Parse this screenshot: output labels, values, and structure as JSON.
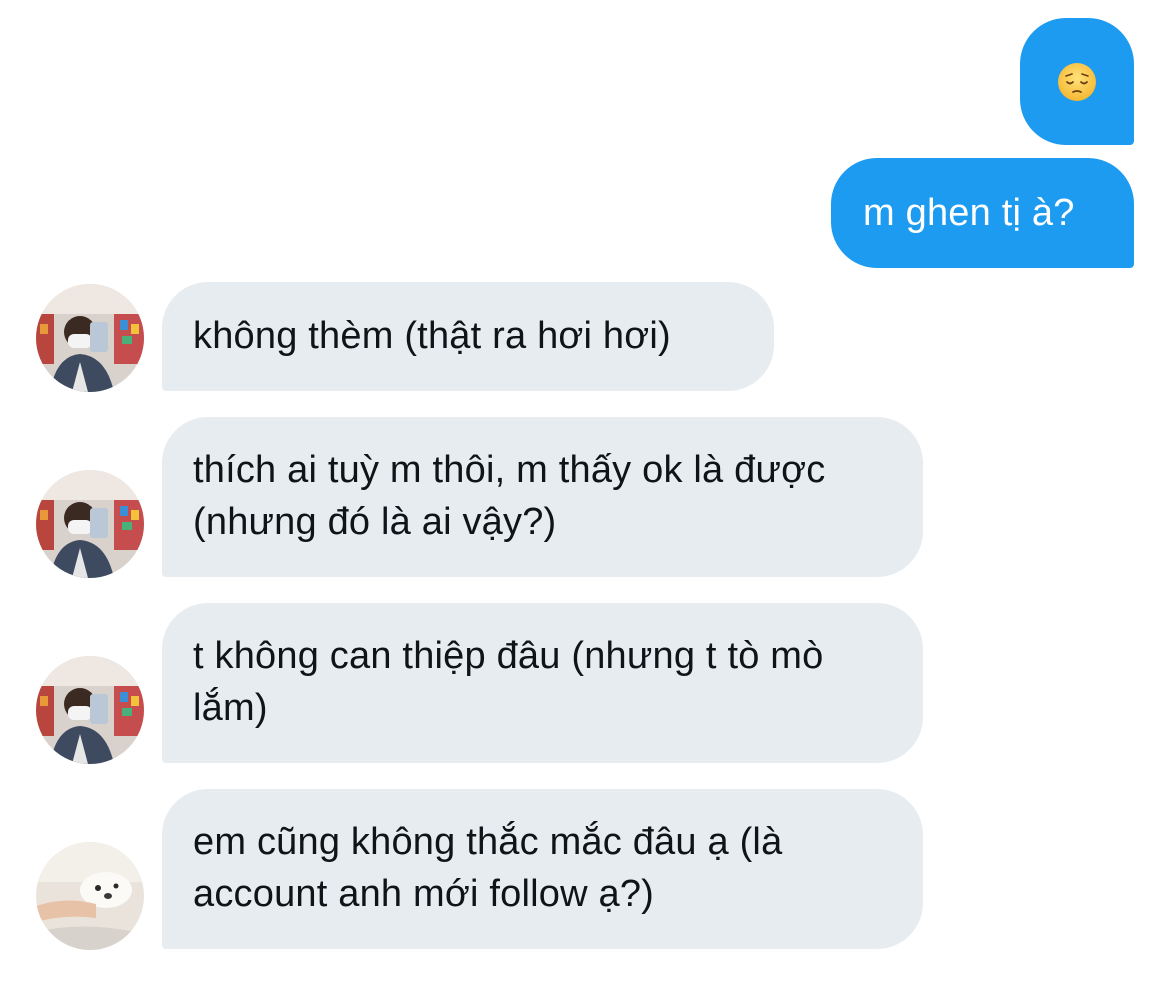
{
  "conversation": {
    "messages": [
      {
        "sender": "me",
        "type": "emoji",
        "emoji": "😔",
        "icon": "pensive-face"
      },
      {
        "sender": "me",
        "text": "m ghen tị à?"
      },
      {
        "sender": "other",
        "text": "không thèm (thật ra hơi hơi)",
        "avatar": "selfie-avatar"
      },
      {
        "sender": "other",
        "text": "thích ai tuỳ m thôi, m thấy ok là được (nhưng đó là ai vậy?)",
        "avatar": "selfie-avatar"
      },
      {
        "sender": "other",
        "text": "t không can thiệp đâu (nhưng t tò mò lắm)",
        "avatar": "selfie-avatar"
      },
      {
        "sender": "other",
        "text": "em cũng không thắc mắc đâu ạ (là account anh mới follow ạ?)",
        "avatar": "dog-avatar"
      }
    ]
  },
  "colors": {
    "sent_bubble": "#1d9bf0",
    "received_bubble": "#e7ecf0",
    "received_text": "#0f1419",
    "sent_text": "#ffffff"
  }
}
